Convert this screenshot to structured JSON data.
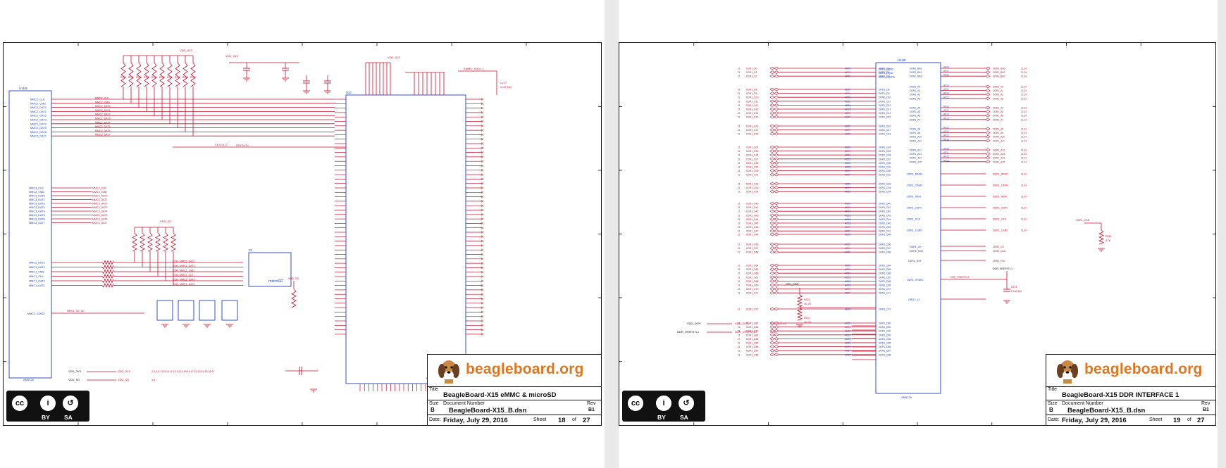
{
  "viewer": {
    "page_bg": "#ffffff",
    "gap_bg": "#e9e9e9"
  },
  "pages": [
    {
      "title_label": "Title",
      "title": "BeagleBoard-X15 eMMC & microSD",
      "size_label": "Size",
      "size": "B",
      "docnum_label": "Document Number",
      "doc_number": "BeagleBoard-X15_B.dsn",
      "rev_label": "Rev",
      "rev": "B1",
      "date_label": "Date:",
      "date": "Friday, July 29, 2016",
      "sheet_label": "Sheet",
      "sheet": "18",
      "of_label": "of",
      "sheet_total": "27",
      "brand": "beagleboard.org",
      "license": {
        "by": "BY",
        "sa": "SA"
      },
      "labels": {
        "u1": "U1H3",
        "mmc2_dat": [
          "MMC2_CLK",
          "MMC2_CMD",
          "MMC2_DAT0",
          "MMC2_DAT1",
          "MMC2_DAT2",
          "MMC2_DAT3",
          "MMC2_DAT4",
          "MMC2_DAT5",
          "MMC2_DAT6",
          "MMC2_DAT7"
        ],
        "mmc3_dat": [
          "MMC3_CLK",
          "MMC3_CMD",
          "MMC3_DAT0",
          "MMC3_DAT1",
          "MMC3_DAT2",
          "MMC3_DAT3",
          "MMC3_DAT4",
          "MMC3_DAT5",
          "MMC3_DAT6",
          "MMC3_DAT7"
        ],
        "mmc1": [
          "MMC1_DAT2",
          "MMC1_DAT3",
          "MMC1_CMD",
          "MMC1_CLK",
          "MMC1_DAT0",
          "MMC1_DAT1"
        ],
        "mmc1_sdcd": "MMC1_SDCD",
        "mmc1_sd_cd": "MMC1_SD_CD",
        "u1_part": "AM5728",
        "vdd_3v3": "VDD_3V3",
        "vdd_sd": "VDD_SD",
        "emmc_vddi": "EMMC_VDDI_1",
        "u22": "U22",
        "u22_part": "MTFC4GMVEA-4M",
        "p_label": "P1",
        "microsd": "microSD",
        "con_mmc1": [
          "CON_MMC1_DAT2",
          "CON_MMC1_DAT3",
          "CON_MMC1_CMD",
          "CON_MMC1_CLK",
          "CON_MMC1_DAT0",
          "CON_MMC1_DAT1"
        ],
        "rstout": "RSTOUTn",
        "sheet_refs": "3,6,9,14,17",
        "pwr_vdd3v3": "VDD_3V3",
        "pwr_vddsd": "VDD_SD",
        "pwr_refs1": "2,3,4,6,7,8,9,10,11,12,13,14,15,16,17,22,23,24,25,26,27",
        "pwr_refs2": "4,6",
        "c270": "C270",
        "c270_v": "0.1uF,16V"
      }
    },
    {
      "title_label": "Title",
      "title": "BeagleBoard-X15 DDR INTERFACE 1",
      "size_label": "Size",
      "size": "B",
      "docnum_label": "Document Number",
      "doc_number": "BeagleBoard-X15_B.dsn",
      "rev_label": "Rev",
      "rev": "B1",
      "date_label": "Date:",
      "date": "Friday, July 29, 2016",
      "sheet_label": "Sheet",
      "sheet": "19",
      "of_label": "of",
      "sheet_total": "27",
      "brand": "beagleboard.org",
      "license": {
        "by": "BY",
        "sa": "SA"
      },
      "labels": {
        "u1": "U1H5",
        "u1_part": "AM5728",
        "dqm": [
          "DDR1_DQM0",
          "DDR1_DQS0",
          "DDR1_DQSN0"
        ],
        "ba": [
          "DDR1_BA0",
          "DDR1_BA1",
          "DDR1_BA2"
        ],
        "ras": "DDR1_RASN",
        "cas": "DDR1_CASN",
        "wen": "DDR1_WEN",
        "odt": "DDR1_ODT0",
        "cke": "DDR1_CKE",
        "csn": "DDR1_CSN0",
        "ck": "DDR1_CK",
        "nck": "DDR1_NCK",
        "rst": "DDR1_RST",
        "vref": "DDR1_VREF0",
        "vref_net": "DDR_VREFSTL1",
        "vdd_ddr": "VDD_DDR",
        "gnd_11": "GROT_11",
        "r333": "R333",
        "r333_v": "4.7K",
        "cke_right": "DDR1_CKE",
        "c273": "C273",
        "c273_v": "0.1uF,16V",
        "r273": "R273",
        "r273_v": "1K,1%",
        "r274": "R274",
        "r274_v": "1K,1%",
        "refs": "3,10,21,23,24",
        "ref_24": "21,24",
        "ref_2124": "21,24"
      }
    }
  ],
  "chart_colors": {
    "wire": "#c8102e",
    "part": "#1f3fbf",
    "frame": "#111111",
    "brand": "#e0761f"
  }
}
